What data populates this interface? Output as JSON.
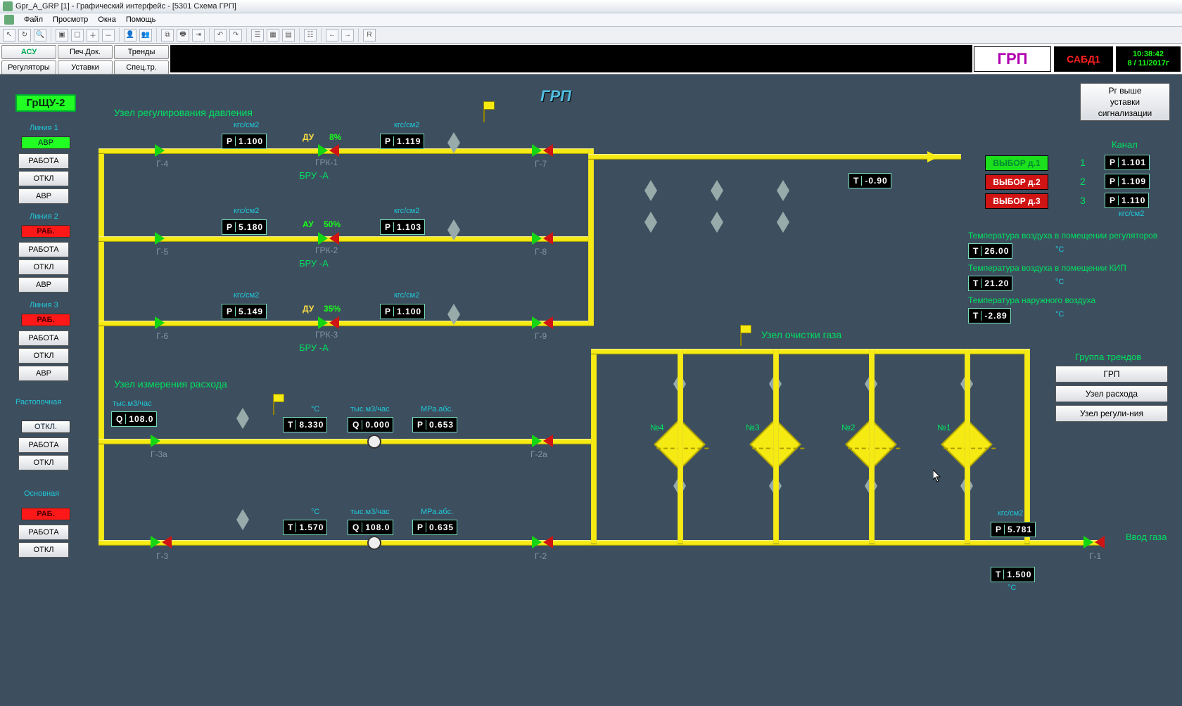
{
  "window": {
    "title": "Gpr_A_GRP [1] - Графический интерфейс - [5301 Схема ГРП]"
  },
  "menu": {
    "file": "Файл",
    "view": "Просмотр",
    "windows": "Окна",
    "help": "Помощь"
  },
  "modes": {
    "asu": "АСУ",
    "pechdoc": "Печ.Док.",
    "trends": "Тренды",
    "regulators": "Регуляторы",
    "ustavki": "Уставки",
    "spectr": "Спец.тр."
  },
  "status": {
    "grp": "ГРП",
    "alarm": "САБД1",
    "time": "10:38:42",
    "date": "8 / 11/2017г"
  },
  "top_alert": {
    "l1": "Рг выше",
    "l2": "уставки",
    "l3": "сигнализации"
  },
  "side": {
    "panel_name": "ГрЩУ-2",
    "lines": [
      {
        "name": "Линия 1",
        "avr_top": "АВР",
        "btns": [
          "РАБОТА",
          "ОТКЛ",
          "АВР"
        ],
        "avr_bg": "green"
      },
      {
        "name": "Линия 2",
        "avr_top": "РАБ.",
        "btns": [
          "РАБОТА",
          "ОТКЛ",
          "АВР"
        ],
        "avr_bg": "red"
      },
      {
        "name": "Линия 3",
        "avr_top": "РАБ.",
        "btns": [
          "РАБОТА",
          "ОТКЛ",
          "АВР"
        ],
        "avr_bg": "red"
      }
    ],
    "rastop": {
      "name": "Растопочная",
      "otkl_top": "ОТКЛ.",
      "btns": [
        "РАБОТА",
        "ОТКЛ"
      ]
    },
    "main": {
      "name": "Основная",
      "rab_top": "РАБ.",
      "btns": [
        "РАБОТА",
        "ОТКЛ"
      ],
      "rab_bg": "red"
    }
  },
  "header": "ГРП",
  "sec_reg": "Узел регулирования давления",
  "sec_flow": "Узел измерения расхода",
  "sec_clean": "Узел очистки газа",
  "vvod": "Ввод газа",
  "units": {
    "kgscm2": "кгс/см2",
    "tm3h": "тыс.м3/час",
    "mpaabs": "МРа.абс.",
    "degC": "°C"
  },
  "lines": {
    "l1": {
      "p1": "1.100",
      "p2": "1.119",
      "du": "ДУ",
      "pct": "8%",
      "grk": "ГРК-1",
      "bru": "БРУ  -А",
      "gL": "Г-4",
      "gR": "Г-7"
    },
    "l2": {
      "p1": "5.180",
      "p2": "1.103",
      "du": "АУ",
      "pct": "50%",
      "grk": "ГРК-2",
      "bru": "БРУ  -А",
      "gL": "Г-5",
      "gR": "Г-8"
    },
    "l3": {
      "p1": "5.149",
      "p2": "1.100",
      "du": "ДУ",
      "pct": "35%",
      "grk": "ГРК-3",
      "bru": "БРУ  -А",
      "gL": "Г-6",
      "gR": "Г-9"
    }
  },
  "flow": {
    "q_side": "108.0",
    "row1": {
      "t": "8.330",
      "q": "0.000",
      "p": "0.653",
      "gL": "Г-3а",
      "gR": "Г-2а"
    },
    "row2": {
      "t": "1.570",
      "q": "108.0",
      "p": "0.635",
      "gL": "Г-3",
      "gR": "Г-2"
    }
  },
  "right": {
    "t_out": "-0.90",
    "kanal": "Канал",
    "selects": [
      {
        "lbl": "ВЫБОР д.1",
        "idx": "1",
        "p": "1.101"
      },
      {
        "lbl": "ВЫБОР д.2",
        "idx": "2",
        "p": "1.109"
      },
      {
        "lbl": "ВЫБОР д.3",
        "idx": "3",
        "p": "1.110"
      }
    ],
    "temp_reg": {
      "lbl": "Температура воздуха в помещении регуляторов",
      "v": "26.00"
    },
    "temp_kip": {
      "lbl": "Температура воздуха в помещении КИП",
      "v": "21.20"
    },
    "temp_ext": {
      "lbl": "Температура наружного воздуха",
      "v": "-2.89"
    },
    "trend_hdr": "Группа трендов",
    "trend_btns": [
      "ГРП",
      "Узел расхода",
      "Узел регули-ния"
    ]
  },
  "filters": [
    "№4",
    "№3",
    "№2",
    "№1"
  ],
  "inlet": {
    "p": "5.781",
    "t": "1.500",
    "g": "Г-1"
  }
}
